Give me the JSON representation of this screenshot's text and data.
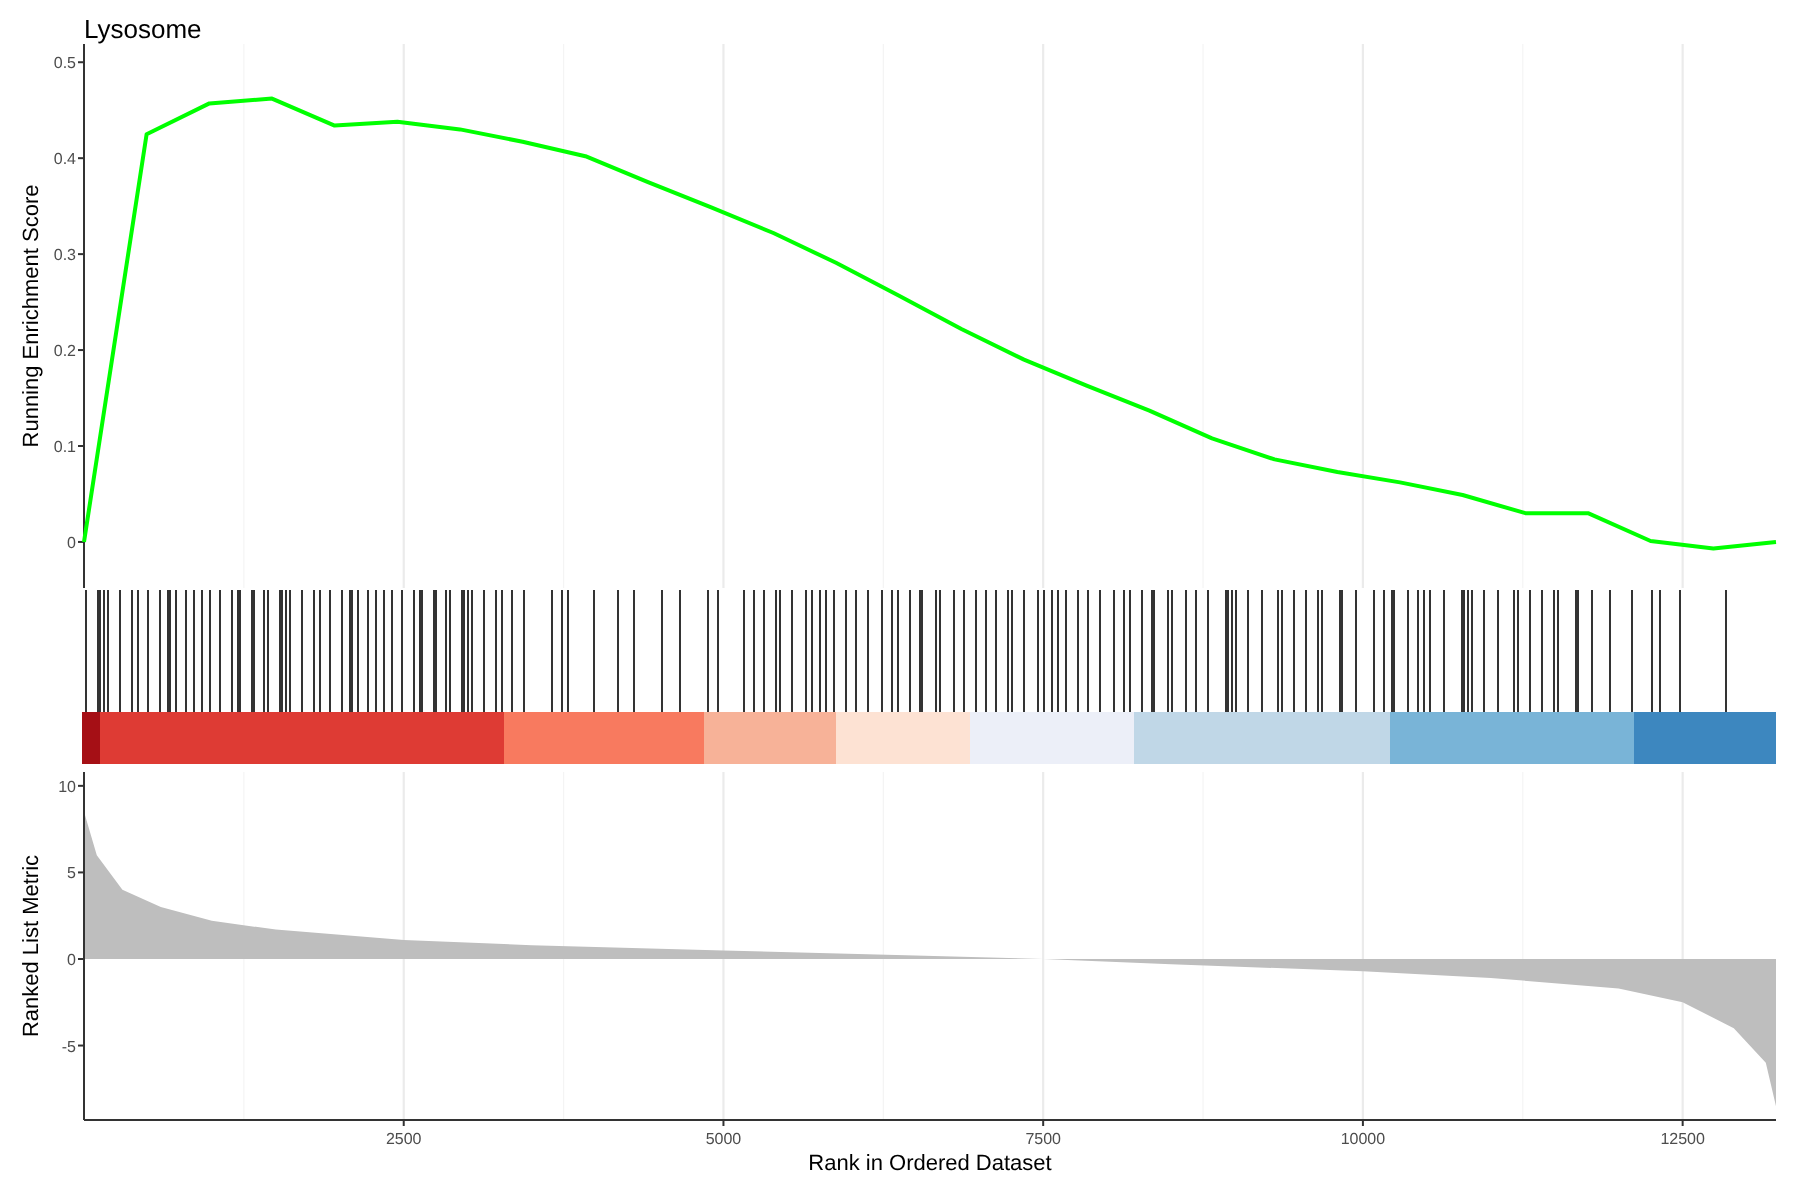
{
  "plot": {
    "title": "Lysosome",
    "es_chart": {
      "chart_data": {
        "type": "line",
        "ylabel": "Running Enrichment Score",
        "ylim": [
          -0.048,
          0.519
        ],
        "yticks": [
          0,
          0.1,
          0.2,
          0.3,
          0.4,
          0.5
        ],
        "grid": true,
        "series": [
          {
            "color": "#00ff00",
            "values": [
              0,
              0.425,
              0.457,
              0.462,
              0.434,
              0.438,
              0.43,
              0.417,
              0.402,
              0.375,
              0.349,
              0.322,
              0.291,
              0.257,
              0.222,
              0.19,
              0.163,
              0.137,
              0.108,
              0.086,
              0.073,
              0.062,
              0.049,
              0.03,
              0.03,
              0.001,
              -0.007,
              0
            ]
          }
        ]
      }
    },
    "metric_chart": {
      "chart_data": {
        "type": "area",
        "xlabel": "Rank in Ordered Dataset",
        "ylabel": "Ranked List Metric",
        "xlim": [
          0,
          13230
        ],
        "ylim": [
          -9.3,
          10.8
        ],
        "xticks": [
          2500,
          5000,
          7500,
          10000,
          12500
        ],
        "yticks": [
          -5,
          0,
          5,
          10
        ],
        "grid": true,
        "x": [
          0,
          100,
          300,
          600,
          1000,
          1500,
          2500,
          3500,
          5000,
          6500,
          7500,
          8500,
          10000,
          11000,
          12000,
          12500,
          12900,
          13150,
          13230
        ],
        "series": [
          {
            "color": "#bebebe",
            "values": [
              8.5,
              6,
              4,
              3,
              2.2,
              1.7,
              1.1,
              0.8,
              0.5,
              0.2,
              0,
              -0.3,
              -0.7,
              -1.1,
              -1.7,
              -2.5,
              -4,
              -6,
              -8.5
            ]
          }
        ]
      }
    }
  }
}
